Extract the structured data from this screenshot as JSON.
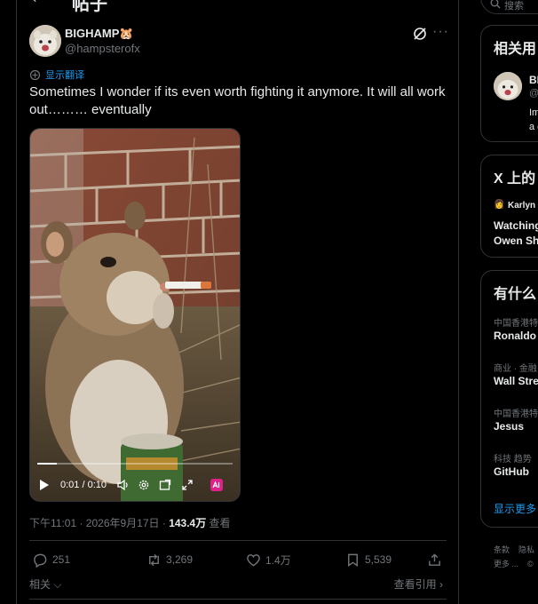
{
  "header": {
    "title": "帖子"
  },
  "post": {
    "display_name": "BIGHAMP🐹",
    "handle": "@hampsterofx",
    "translate_label": "显示翻译",
    "text": "Sometimes I wonder if its even worth fighting it anymore. It will all work out……… eventually",
    "video": {
      "time": "0:01 / 0:10",
      "progress_fraction": 0.1
    },
    "timestamp": "下午11:01 · 2026年9月17日 · ",
    "views_count": "143.4万",
    "views_label": " 查看",
    "stats": {
      "replies": "251",
      "reposts": "3,269",
      "likes": "1.4万",
      "bookmarks": "5,539"
    },
    "related_label": "相关",
    "view_quotes_label": "查看引用"
  },
  "sidebar": {
    "search_placeholder": "搜索",
    "relevant_people": {
      "title": "相关用",
      "name": "BI",
      "handle": "@",
      "bio_line1": "Im",
      "bio_line2": "a c"
    },
    "live": {
      "title": "X 上的",
      "host": "Karlyn",
      "text_line1": "Watching",
      "text_line2": "Owen Sh"
    },
    "whats_happening": {
      "title": "有什么",
      "trends": [
        {
          "category": "中国香港特",
          "name": "Ronaldo"
        },
        {
          "category": "商业 · 金融",
          "name": "Wall Stre"
        },
        {
          "category": "中国香港特",
          "name": "Jesus"
        },
        {
          "category": "科技 趋势",
          "name": "GitHub"
        }
      ],
      "show_more": "显示更多"
    },
    "footer": {
      "line1_a": "条款",
      "line1_b": "隐私",
      "line2_a": "更多 ...",
      "line2_b": "©"
    }
  },
  "colors": {
    "background": "#000000",
    "text_primary": "#e7e9ea",
    "text_secondary": "#71767b",
    "accent": "#1d9bf0",
    "border": "#2f3336"
  }
}
